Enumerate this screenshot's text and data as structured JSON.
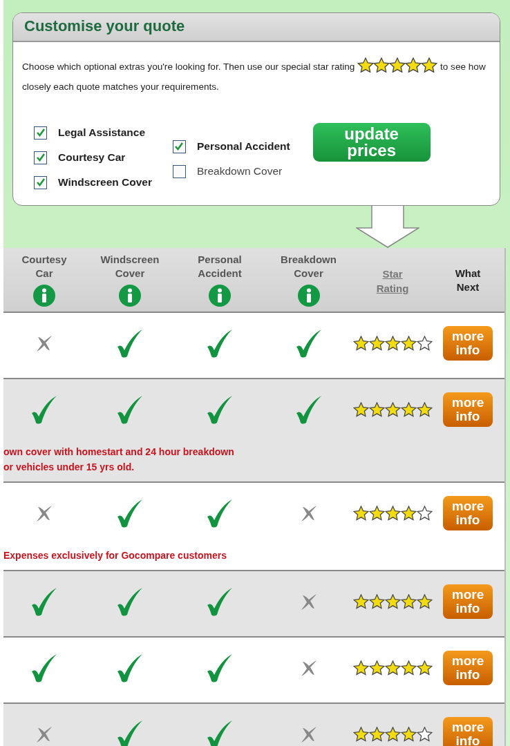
{
  "panel": {
    "title": "Customise your quote",
    "intro_before": "Choose which optional extras you're looking for. Then use our special star rating",
    "intro_after": "to see how closely each quote matches your requirements.",
    "extras_columns": [
      [
        {
          "label": "Legal Assistance",
          "checked": true
        },
        {
          "label": "Courtesy Car",
          "checked": true
        },
        {
          "label": "Windscreen Cover",
          "checked": true
        }
      ],
      [
        {
          "label": "Personal Accident",
          "checked": true
        },
        {
          "label": "Breakdown Cover",
          "checked": false
        }
      ]
    ],
    "update_button": "update prices"
  },
  "table": {
    "columns": [
      {
        "kind": "extra",
        "label": "Courtesy Car"
      },
      {
        "kind": "extra",
        "label": "Windscreen Cover"
      },
      {
        "kind": "extra",
        "label": "Personal Accident"
      },
      {
        "kind": "extra",
        "label": "Breakdown Cover"
      },
      {
        "kind": "link",
        "label": "Star Rating"
      },
      {
        "kind": "plain",
        "label": "What Next"
      }
    ],
    "rows": [
      {
        "included": [
          false,
          true,
          true,
          true
        ],
        "stars": 4,
        "button": "more info"
      },
      {
        "included": [
          true,
          true,
          true,
          true
        ],
        "stars": 5,
        "button": "more info",
        "note": "own cover with homestart and 24 hour breakdown\nor vehicles under 15 yrs old."
      },
      {
        "included": [
          false,
          true,
          true,
          false
        ],
        "stars": 4,
        "button": "more info",
        "note": "Expenses exclusively for Gocompare customers"
      },
      {
        "included": [
          true,
          true,
          true,
          false
        ],
        "stars": 5,
        "button": "more info"
      },
      {
        "included": [
          true,
          true,
          true,
          false
        ],
        "stars": 5,
        "button": "more info"
      },
      {
        "included": [
          false,
          true,
          true,
          false
        ],
        "stars": 4,
        "button": "more info"
      }
    ]
  }
}
